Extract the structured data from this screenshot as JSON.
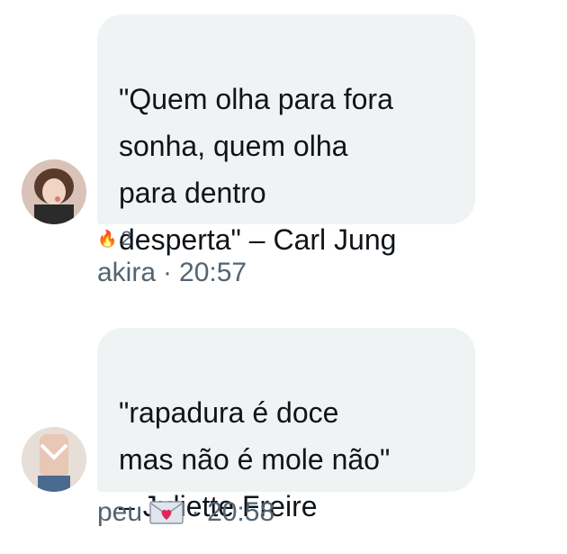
{
  "messages": [
    {
      "text": "\"Quem olha para fora\nsonha, quem olha\npara dentro\ndesperta\" – Carl Jung",
      "reaction": {
        "icon": "fire-icon",
        "count": "2"
      },
      "author": "akira",
      "separator": "·",
      "time": "20:57"
    },
    {
      "text": "\"rapadura é doce\nmas não é mole não\"\n– Juliette Freire",
      "author": "peu",
      "author_icon": "envelope-heart-icon",
      "separator": "·",
      "time": "20:58"
    }
  ],
  "colors": {
    "bubble_bg": "#eff3f4",
    "text": "#0f1419",
    "meta": "#536471"
  }
}
